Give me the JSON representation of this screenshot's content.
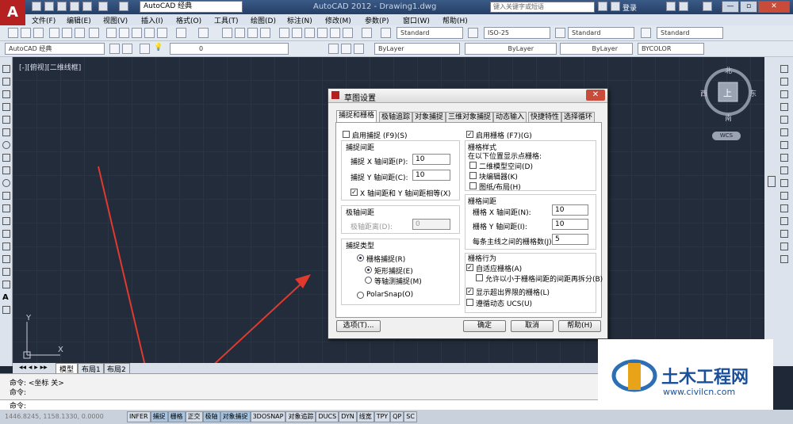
{
  "app": {
    "title": "AutoCAD 2012 - Drawing1.dwg",
    "logo": "A",
    "workspace": "AutoCAD 经典",
    "search_placeholder": "键入关键字或短语",
    "login": "登录"
  },
  "window_buttons": [
    "—",
    "▫",
    "✕"
  ],
  "menu": [
    "文件(F)",
    "编辑(E)",
    "视图(V)",
    "插入(I)",
    "格式(O)",
    "工具(T)",
    "绘图(D)",
    "标注(N)",
    "修改(M)",
    "参数(P)",
    "窗口(W)",
    "帮助(H)"
  ],
  "styles": {
    "text": "Standard",
    "dim": "ISO-25",
    "table": "Standard",
    "mleader": "Standard"
  },
  "layers": {
    "workspace": "AutoCAD 经典",
    "layer": "0",
    "color": "ByLayer",
    "linetype": "ByLayer",
    "lineweight": "ByLayer",
    "plotstyle": "BYCOLOR"
  },
  "viewport": {
    "label": "[-][俯视][二维线框]",
    "cube_n": "北",
    "cube_s": "南",
    "cube_e": "东",
    "cube_w": "西",
    "cube_top": "上",
    "wcs": "WCS",
    "axis_x": "X",
    "axis_y": "Y"
  },
  "layout_tabs": [
    "模型",
    "布局1",
    "布局2"
  ],
  "command": {
    "line1": "命令:  <坐标 关>",
    "line2": "命令:",
    "line3": "命令:"
  },
  "status": {
    "coords": "1446.8245, 1158.1330, 0.0000",
    "buttons": [
      {
        "label": "INFER",
        "on": false
      },
      {
        "label": "捕捉",
        "on": true
      },
      {
        "label": "栅格",
        "on": true
      },
      {
        "label": "正交",
        "on": false
      },
      {
        "label": "极轴",
        "on": true
      },
      {
        "label": "对象捕捉",
        "on": true
      },
      {
        "label": "3DOSNAP",
        "on": false
      },
      {
        "label": "对象追踪",
        "on": false
      },
      {
        "label": "DUCS",
        "on": false
      },
      {
        "label": "DYN",
        "on": false
      },
      {
        "label": "线宽",
        "on": false
      },
      {
        "label": "TPY",
        "on": false
      },
      {
        "label": "QP",
        "on": false
      },
      {
        "label": "SC",
        "on": false
      }
    ]
  },
  "dialog": {
    "title": "草图设置",
    "tabs": [
      "捕捉和栅格",
      "极轴追踪",
      "对象捕捉",
      "三维对象捕捉",
      "动态输入",
      "快捷特性",
      "选择循环"
    ],
    "snap_on": "启用捕捉 (F9)(S)",
    "snap_spacing": "捕捉间距",
    "snap_x_label": "捕捉 X 轴间距(P):",
    "snap_x": "10",
    "snap_y_label": "捕捉 Y 轴间距(C):",
    "snap_y": "10",
    "equal_xy": "X 轴间距和 Y 轴间距相等(X)",
    "polar_spacing": "极轴间距",
    "polar_distance_label": "极轴距离(D):",
    "polar_distance": "0",
    "snap_type": "捕捉类型",
    "grid_snap": "栅格捕捉(R)",
    "rect_snap": "矩形捕捉(E)",
    "iso_snap": "等轴测捕捉(M)",
    "polar_snap": "PolarSnap(O)",
    "grid_on": "启用栅格 (F7)(G)",
    "grid_style": "栅格样式",
    "grid_style_hint": "在以下位置显示点栅格:",
    "grid_2d": "二维模型空间(D)",
    "grid_block": "块编辑器(K)",
    "grid_sheet": "图纸/布局(H)",
    "grid_spacing": "栅格间距",
    "grid_x_label": "栅格 X 轴间距(N):",
    "grid_x": "10",
    "grid_y_label": "栅格 Y 轴间距(I):",
    "grid_y": "10",
    "major_label": "每条主线之间的栅格数(J):",
    "major": "5",
    "grid_behavior": "栅格行为",
    "adaptive": "自适应栅格(A)",
    "subdivide": "允许以小于栅格间距的间距再拆分(B)",
    "beyond_limits": "显示超出界限的栅格(L)",
    "follow_ucs": "遵循动态 UCS(U)",
    "options_btn": "选项(T)...",
    "ok_btn": "确定",
    "cancel_btn": "取消",
    "help_btn": "帮助(H)"
  },
  "watermark": {
    "title": "土木工程网",
    "url": "www.civilcn.com"
  }
}
